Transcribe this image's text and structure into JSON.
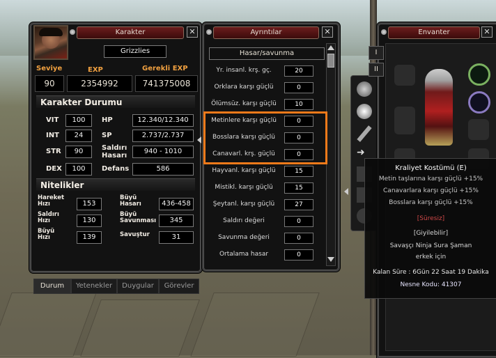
{
  "character_window": {
    "title": "Karakter",
    "name": "Grizzlies",
    "level_label": "Seviye",
    "level": "90",
    "exp_label": "EXP",
    "exp": "2354992",
    "req_exp_label": "Gerekli EXP",
    "req_exp": "741375008",
    "status_header": "Karakter Durumu",
    "stats": {
      "vit_label": "VIT",
      "vit": "100",
      "int_label": "INT",
      "int": "24",
      "str_label": "STR",
      "str": "90",
      "dex_label": "DEX",
      "dex": "100",
      "hp_label": "HP",
      "hp": "12.340/12.340",
      "sp_label": "SP",
      "sp": "2.737/2.737",
      "attack_label_1": "Saldırı",
      "attack_label_2": "Hasarı",
      "attack": "940 - 1010",
      "defense_label": "Defans",
      "defense": "586"
    },
    "traits_header": "Nitelikler",
    "traits": {
      "move_speed_1": "Hareket",
      "move_speed_2": "Hızı",
      "move_speed": "153",
      "attack_speed_1": "Saldırı",
      "attack_speed_2": "Hızı",
      "attack_speed": "130",
      "magic_speed_1": "Büyü",
      "magic_speed_2": "Hızı",
      "magic_speed": "139",
      "magic_dmg_1": "Büyü",
      "magic_dmg_2": "Hasarı",
      "magic_dmg": "436-458",
      "magic_def_1": "Büyü",
      "magic_def_2": "Savunması",
      "magic_def": "345",
      "evasion_label": "Savuştur",
      "evasion": "31"
    },
    "tabs": [
      "Durum",
      "Yetenekler",
      "Duygular",
      "Görevler"
    ]
  },
  "details_window": {
    "title": "Ayrıntılar",
    "section": "Hasar/savunma",
    "rows": [
      {
        "name": "Yr. insanl. krş. gç.",
        "value": "20"
      },
      {
        "name": "Orklara karşı güçlü",
        "value": "0"
      },
      {
        "name": "Ölümsüz. karşı güçlü",
        "value": "10"
      },
      {
        "name": "Metinlere karşı güçlü",
        "value": "0"
      },
      {
        "name": "Bosslara karşı güçlü",
        "value": "0"
      },
      {
        "name": "Canavarl. krş. güçlü",
        "value": "0"
      },
      {
        "name": "Hayvanl. karşı güçlü",
        "value": "15"
      },
      {
        "name": "Mistikl. karşı güçlü",
        "value": "15"
      },
      {
        "name": "Şeytanl. karşı güçlü",
        "value": "27"
      },
      {
        "name": "Saldırı değeri",
        "value": "0"
      },
      {
        "name": "Savunma değeri",
        "value": "0"
      },
      {
        "name": "Ortalama hasar",
        "value": "0"
      }
    ],
    "highlight_color": "#f07a1a"
  },
  "inventory_window": {
    "title": "Envanter",
    "page_tabs": [
      "I",
      "II"
    ]
  },
  "tooltip": {
    "item_name": "Kraliyet Kostümü (E)",
    "bonus_1": "Metin taşlarına karşı güçlü +15%",
    "bonus_2": "Canavarlara karşı güçlü +15%",
    "bonus_3": "Bosslara karşı güçlü +15%",
    "duration_tag": "[Süresiz]",
    "wearable_label": "[Giyilebilir]",
    "classes": "Savaşçı Ninja Sura Şaman",
    "gender": "erkek için",
    "remaining": "Kalan Süre : 6Gün 22 Saat 19 Dakika",
    "code_label": "Nesne Kodu:",
    "code": "41307",
    "colors": {
      "bonus": "#c8c8c8",
      "duration": "#d04848",
      "code": "#e8e6ff"
    }
  },
  "icons": [
    "close-icon",
    "portrait",
    "scroll-up-arrow",
    "scroll-down-arrow",
    "ring-icon",
    "armor-icon"
  ]
}
